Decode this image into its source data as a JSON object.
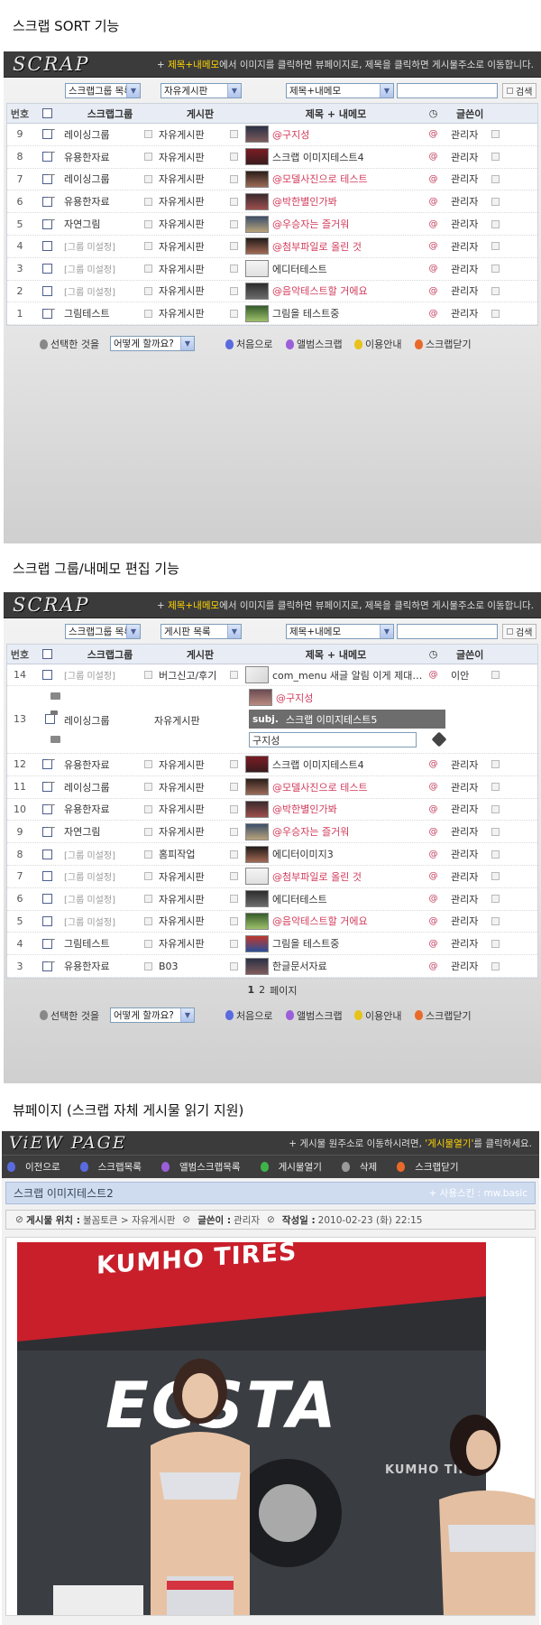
{
  "section1_title": "스크랩 SORT 기능",
  "section2_title": "스크랩 그룹/내메모 편집 기능",
  "section3_title": "뷰페이지 (스크랩 자체 게시물 읽기 지원)",
  "logo": "SCRAP",
  "header_msg_prefix": "+ ",
  "header_msg_highlight": "제목+내메모",
  "header_msg_suffix": "에서 이미지를 클릭하면 뷰페이지로, 제목을 클릭하면 게시물주소로 이동합니다.",
  "search_button": "검색",
  "columns": {
    "num": "번호",
    "group": "스크랩그룹",
    "board": "게시판",
    "subject": "제목 + 내메모",
    "writer": "글쓴이"
  },
  "filter1": {
    "group": "스크랩그룹 목록",
    "board": "자유게시판",
    "field": "제목+내메모"
  },
  "filter2": {
    "group": "스크랩그룹 목록",
    "board": "게시판 목록",
    "field": "제목+내메모"
  },
  "colors": {
    "header": "#3b3b3b",
    "highlight": "#ffd400",
    "memo": "#d23b5a"
  },
  "rows1": [
    {
      "num": "9",
      "group": "레이싱그룹",
      "board": "자유게시판",
      "subject": "@구지성",
      "writer": "관리자"
    },
    {
      "num": "8",
      "group": "유용한자료",
      "board": "자유게시판",
      "subject": "스크랩 이미지테스트4",
      "writer": "관리자"
    },
    {
      "num": "7",
      "group": "레이싱그룹",
      "board": "자유게시판",
      "subject": "@모델사진으로 테스트",
      "writer": "관리자"
    },
    {
      "num": "6",
      "group": "유용한자료",
      "board": "자유게시판",
      "subject": "@박한별인가봐",
      "writer": "관리자"
    },
    {
      "num": "5",
      "group": "자연그림",
      "board": "자유게시판",
      "subject": "@우승자는 즐거워",
      "writer": "관리자"
    },
    {
      "num": "4",
      "group": "[그룹 미설정]",
      "board": "자유게시판",
      "subject": "@첨부파일로 올린 것",
      "writer": "관리자"
    },
    {
      "num": "3",
      "group": "[그룹 미설정]",
      "board": "자유게시판",
      "subject": "에디터테스트",
      "writer": "관리자"
    },
    {
      "num": "2",
      "group": "[그룹 미설정]",
      "board": "자유게시판",
      "subject": "@음악테스트할 거에요",
      "writer": "관리자"
    },
    {
      "num": "1",
      "group": "그림테스트",
      "board": "자유게시판",
      "subject": "그림을 테스트중",
      "writer": "관리자"
    }
  ],
  "bottom": {
    "label": "선택한 것을",
    "select": "어떻게 할까요?",
    "links": [
      "처음으로",
      "앨범스크랩",
      "이용안내",
      "스크랩닫기"
    ]
  },
  "row14": {
    "num": "14",
    "group": "[그룹 미설정]",
    "board": "버그신고/후기",
    "subject": "com_menu 새글 알림 이게 제대…",
    "writer": "이안"
  },
  "row13": {
    "num": "13",
    "group": "레이싱그룹",
    "board": "자유게시판",
    "memo": "@구지성",
    "subj_tag": "subj.",
    "subj": "스크랩 이미지테스트5",
    "edit_value": "구지성"
  },
  "rows2": [
    {
      "num": "12",
      "group": "유용한자료",
      "board": "자유게시판",
      "subject": "스크랩 이미지테스트4",
      "writer": "관리자"
    },
    {
      "num": "11",
      "group": "레이싱그룹",
      "board": "자유게시판",
      "subject": "@모델사진으로 테스트",
      "writer": "관리자"
    },
    {
      "num": "10",
      "group": "유용한자료",
      "board": "자유게시판",
      "subject": "@박한별인가봐",
      "writer": "관리자"
    },
    {
      "num": "9",
      "group": "자연그림",
      "board": "자유게시판",
      "subject": "@우승자는 즐거워",
      "writer": "관리자"
    },
    {
      "num": "8",
      "group": "[그룹 미설정]",
      "board": "홈피작업",
      "subject": "에디터이미지3",
      "writer": "관리자"
    },
    {
      "num": "7",
      "group": "[그룹 미설정]",
      "board": "자유게시판",
      "subject": "@첨부파일로 올린 것",
      "writer": "관리자"
    },
    {
      "num": "6",
      "group": "[그룹 미설정]",
      "board": "자유게시판",
      "subject": "에디터테스트",
      "writer": "관리자"
    },
    {
      "num": "5",
      "group": "[그룹 미설정]",
      "board": "자유게시판",
      "subject": "@음악테스트할 거에요",
      "writer": "관리자"
    },
    {
      "num": "4",
      "group": "그림테스트",
      "board": "자유게시판",
      "subject": "그림을 테스트중",
      "writer": "관리자"
    },
    {
      "num": "3",
      "group": "유용한자료",
      "board": "B03",
      "subject": "한글문서자료",
      "writer": "관리자"
    }
  ],
  "pagination": {
    "p1": "1",
    "p2": "2",
    "suffix": "페이지"
  },
  "view": {
    "logo": "ViEW PAGE",
    "msg_prefix": "+ 게시물 원주소로 이동하시려면, ",
    "msg_highlight": "'게시물열기'",
    "msg_suffix": "를 클릭하세요.",
    "nav": [
      "이전으로",
      "스크랩목록",
      "앨범스크랩목록",
      "게시물열기",
      "삭제",
      "스크랩닫기"
    ],
    "title": "스크랩 이미지테스트2",
    "skin": "+ 사용스킨 : mw.basic",
    "loc_label": "게시물 위치 :",
    "loc_value": "불꼼토큰 > 자유게시판",
    "writer_label": "글쓴이 :",
    "writer_value": "관리자",
    "date_label": "작성일 :",
    "date_value": "2010-02-23 (화) 22:15",
    "photo_banner": "KUMHO TIRES",
    "photo_logo": "ECSTA",
    "photo_sign": "KUMHO TIF"
  }
}
